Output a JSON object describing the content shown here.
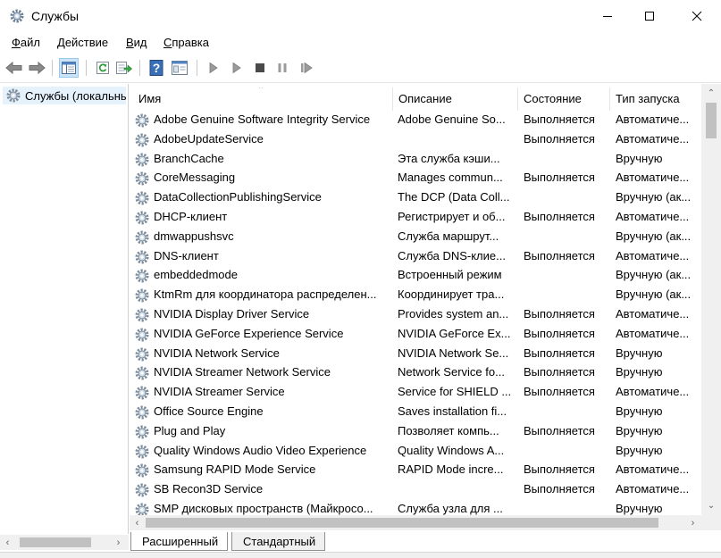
{
  "window": {
    "title": "Службы",
    "icon": "services-gear-icon"
  },
  "controls": {
    "minimize": "minimize-icon",
    "maximize": "maximize-icon",
    "close": "close-icon"
  },
  "menu": [
    {
      "label": "Файл",
      "accel": "Ф",
      "rest": "айл"
    },
    {
      "label": "Действие",
      "accel": "Д",
      "rest": "ействие"
    },
    {
      "label": "Вид",
      "accel": "В",
      "rest": "ид"
    },
    {
      "label": "Справка",
      "accel": "С",
      "rest": "правка"
    }
  ],
  "toolbar": {
    "buttons": [
      "back-arrow-icon",
      "forward-arrow-icon",
      "show-hide-console-tree-icon",
      "refresh-icon",
      "export-list-icon",
      "help-icon",
      "properties-icon",
      "start-service-icon",
      "start-service-alt-icon",
      "stop-service-icon",
      "pause-service-icon",
      "resume-service-icon"
    ],
    "accent": "#2a6fbf"
  },
  "tree": {
    "label": "Службы (локальные)"
  },
  "columns": {
    "name": "Имя",
    "description": "Описание",
    "status": "Состояние",
    "startup": "Тип запуска"
  },
  "services": [
    {
      "name": "Adobe Genuine Software Integrity Service",
      "description": "Adobe Genuine So...",
      "status": "Выполняется",
      "startup": "Автоматиче..."
    },
    {
      "name": "AdobeUpdateService",
      "description": "",
      "status": "Выполняется",
      "startup": "Автоматиче..."
    },
    {
      "name": "BranchCache",
      "description": "Эта служба кэши...",
      "status": "",
      "startup": "Вручную"
    },
    {
      "name": "CoreMessaging",
      "description": "Manages commun...",
      "status": "Выполняется",
      "startup": "Автоматиче..."
    },
    {
      "name": "DataCollectionPublishingService",
      "description": "The DCP (Data Coll...",
      "status": "",
      "startup": "Вручную (ак..."
    },
    {
      "name": "DHCP-клиент",
      "description": "Регистрирует и об...",
      "status": "Выполняется",
      "startup": "Автоматиче..."
    },
    {
      "name": "dmwappushsvc",
      "description": "Служба маршрут...",
      "status": "",
      "startup": "Вручную (ак..."
    },
    {
      "name": "DNS-клиент",
      "description": "Служба DNS-клие...",
      "status": "Выполняется",
      "startup": "Автоматиче..."
    },
    {
      "name": "embeddedmode",
      "description": "Встроенный режим",
      "status": "",
      "startup": "Вручную (ак..."
    },
    {
      "name": "KtmRm для координатора распределен...",
      "description": "Координирует тра...",
      "status": "",
      "startup": "Вручную (ак..."
    },
    {
      "name": "NVIDIA Display Driver Service",
      "description": "Provides system an...",
      "status": "Выполняется",
      "startup": "Автоматиче..."
    },
    {
      "name": "NVIDIA GeForce Experience Service",
      "description": "NVIDIA GeForce Ex...",
      "status": "Выполняется",
      "startup": "Автоматиче..."
    },
    {
      "name": "NVIDIA Network Service",
      "description": "NVIDIA Network Se...",
      "status": "Выполняется",
      "startup": "Вручную"
    },
    {
      "name": "NVIDIA Streamer Network Service",
      "description": "Network Service fo...",
      "status": "Выполняется",
      "startup": "Вручную"
    },
    {
      "name": "NVIDIA Streamer Service",
      "description": "Service for SHIELD ...",
      "status": "Выполняется",
      "startup": "Автоматиче..."
    },
    {
      "name": "Office  Source Engine",
      "description": "Saves installation fi...",
      "status": "",
      "startup": "Вручную"
    },
    {
      "name": "Plug and Play",
      "description": "Позволяет компь...",
      "status": "Выполняется",
      "startup": "Вручную"
    },
    {
      "name": "Quality Windows Audio Video Experience",
      "description": "Quality Windows A...",
      "status": "",
      "startup": "Вручную"
    },
    {
      "name": "Samsung RAPID Mode Service",
      "description": "RAPID Mode incre...",
      "status": "Выполняется",
      "startup": "Автоматиче..."
    },
    {
      "name": "SB Recon3D Service",
      "description": "",
      "status": "Выполняется",
      "startup": "Автоматиче..."
    },
    {
      "name": "SMP дисковых пространств (Майкросо...",
      "description": "Служба узла для ...",
      "status": "",
      "startup": "Вручную"
    }
  ],
  "tabs": {
    "extended": "Расширенный",
    "standard": "Стандартный"
  }
}
